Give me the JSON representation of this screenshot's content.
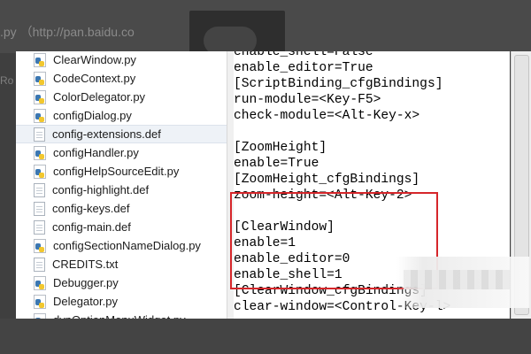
{
  "background": {
    "link_text": ".py （http://pan.baidu.co",
    "side_text": "Ro"
  },
  "explorer": {
    "files": [
      {
        "name": "ClearWindow.py",
        "icon": "python-file-icon",
        "selected": false
      },
      {
        "name": "CodeContext.py",
        "icon": "python-file-icon",
        "selected": false
      },
      {
        "name": "ColorDelegator.py",
        "icon": "python-file-icon",
        "selected": false
      },
      {
        "name": "configDialog.py",
        "icon": "python-file-icon",
        "selected": false
      },
      {
        "name": "config-extensions.def",
        "icon": "text-file-icon",
        "selected": true
      },
      {
        "name": "configHandler.py",
        "icon": "python-file-icon",
        "selected": false
      },
      {
        "name": "configHelpSourceEdit.py",
        "icon": "python-file-icon",
        "selected": false
      },
      {
        "name": "config-highlight.def",
        "icon": "text-file-icon",
        "selected": false
      },
      {
        "name": "config-keys.def",
        "icon": "text-file-icon",
        "selected": false
      },
      {
        "name": "config-main.def",
        "icon": "text-file-icon",
        "selected": false
      },
      {
        "name": "configSectionNameDialog.py",
        "icon": "python-file-icon",
        "selected": false
      },
      {
        "name": "CREDITS.txt",
        "icon": "text-file-icon",
        "selected": false
      },
      {
        "name": "Debugger.py",
        "icon": "python-file-icon",
        "selected": false
      },
      {
        "name": "Delegator.py",
        "icon": "python-file-icon",
        "selected": false
      },
      {
        "name": "dynOptionMenuWidget.py",
        "icon": "python-file-icon",
        "selected": false
      }
    ]
  },
  "editor": {
    "lines": [
      "enable_shell=False",
      "enable_editor=True",
      "[ScriptBinding_cfgBindings]",
      "run-module=<Key-F5>",
      "check-module=<Alt-Key-x>",
      "",
      "[ZoomHeight]",
      "enable=True",
      "[ZoomHeight_cfgBindings]",
      "zoom-height=<Alt-Key-2>",
      "",
      "[ClearWindow]",
      "enable=1",
      "enable_editor=0",
      "enable_shell=1",
      "[ClearWindow_cfgBindings]",
      "clear-window=<Control-Key-l>"
    ],
    "highlight_color": "#d6262a"
  }
}
